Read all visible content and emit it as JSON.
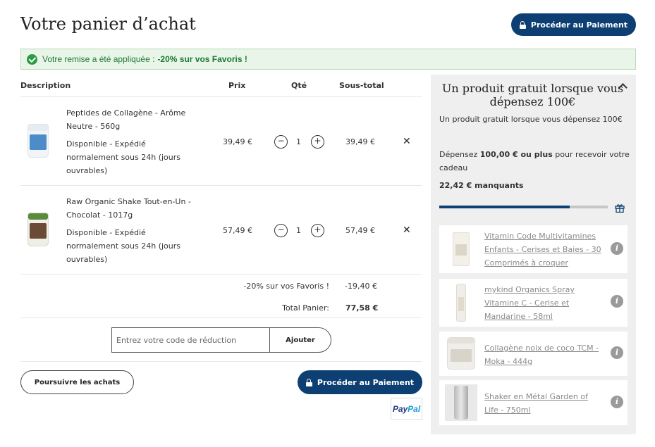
{
  "page": {
    "title": "Votre panier d’achat"
  },
  "checkout": {
    "label": "Procéder au Paiement"
  },
  "banner": {
    "text": "Votre remise a été appliquée : ",
    "bold": "-20% sur vos Favoris !"
  },
  "table": {
    "headers": {
      "description": "Description",
      "price": "Prix",
      "qty": "Qté",
      "subtotal": "Sous-total"
    }
  },
  "items": [
    {
      "name": "Peptides de Collagène - Arôme Neutre - 560g",
      "stock": "Disponible - Expédié normalement sous 24h (jours ouvrables)",
      "price": "39,49 €",
      "qty": "1",
      "subtotal": "39,49 €"
    },
    {
      "name": "Raw Organic Shake Tout-en-Un - Chocolat - 1017g",
      "stock": "Disponible - Expédié normalement sous 24h (jours ouvrables)",
      "price": "57,49 €",
      "qty": "1",
      "subtotal": "57,49 €"
    }
  ],
  "summary": {
    "discount_label": "-20% sur vos Favoris !",
    "discount_value": "-19,40 €",
    "total_label": "Total Panier:",
    "total_value": "77,58 €"
  },
  "coupon": {
    "placeholder": "Entrez votre code de réduction",
    "apply_label": "Ajouter"
  },
  "actions": {
    "continue_label": "Poursuivre les achats"
  },
  "paypal": {
    "part1": "Pay",
    "part2": "Pal"
  },
  "sidebar": {
    "title": "Un produit gratuit lorsque vous dépensez 100€",
    "subtitle": "Un produit gratuit lorsque vous dépensez 100€",
    "info_prefix": "Dépensez ",
    "info_bold": "100,00 € ou plus",
    "info_suffix": " pour recevoir votre cadeau",
    "missing": "22,42 € manquants",
    "progress_percent": 77.58,
    "gifts": [
      {
        "name": "Vitamin Code Multivitamines Enfants - Cerises et Baies - 30 Comprimés à croquer"
      },
      {
        "name": "mykind Organics Spray Vitamine C - Cerise et Mandarine - 58ml"
      },
      {
        "name": "Collagène noix de coco TCM - Moka - 444g"
      },
      {
        "name": "Shaker en Métal Garden of Life - 750ml"
      }
    ]
  },
  "colors": {
    "primary": "#0d3f73",
    "success": "#2c9b45",
    "banner_bg": "#e9f5e8",
    "sidebar_bg": "#efefef"
  }
}
